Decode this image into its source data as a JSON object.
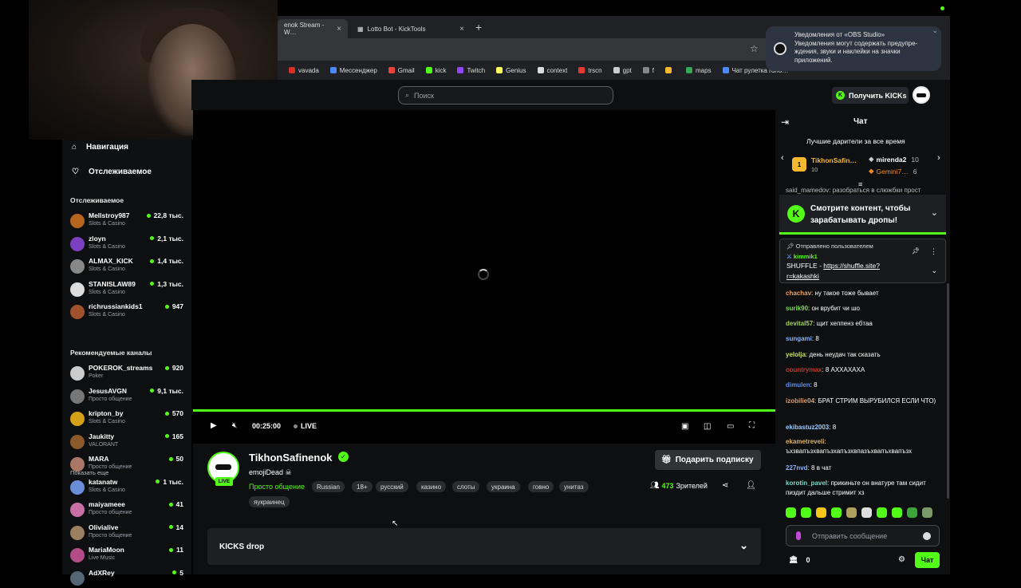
{
  "browser": {
    "tabs": [
      {
        "label": "enok Stream - W…"
      },
      {
        "label": "Lotto Bot - KickTools"
      }
    ],
    "new_tab": "+",
    "bookmarks": [
      {
        "label": "vavada",
        "color": "#d93025"
      },
      {
        "label": "Мессенджер",
        "color": "#4a8af4"
      },
      {
        "label": "Gmail",
        "color": "#ea4335"
      },
      {
        "label": "kick",
        "color": "#53fc18"
      },
      {
        "label": "Twitch",
        "color": "#9146ff"
      },
      {
        "label": "Genius",
        "color": "#ffff64"
      },
      {
        "label": "context",
        "color": "#dddddd"
      },
      {
        "label": "trscn",
        "color": "#e53935"
      },
      {
        "label": "gpt",
        "color": "#cccccc"
      },
      {
        "label": "f",
        "color": "#888888"
      },
      {
        "label": "",
        "color": "#f5b82e"
      },
      {
        "label": "maps",
        "color": "#34a853"
      },
      {
        "label": "Чат рулетка голо…",
        "color": "#4a8af4"
      }
    ]
  },
  "notification": {
    "title": "Уведомления от «OBS Studio»",
    "body": "Уведомления могут содержать предупре-ждения, звуки и наклейки на значки приложений."
  },
  "header": {
    "search_placeholder": "Поиск",
    "get_kicks": "Получить KICKs"
  },
  "sidebar": {
    "nav": [
      {
        "label": "Навигация",
        "icon": "home-icon"
      },
      {
        "label": "Отслеживаемое",
        "icon": "heart-icon"
      }
    ],
    "following_heading": "Отслеживаемое",
    "following": [
      {
        "name": "Mellstroy987",
        "category": "Slots & Casino",
        "viewers": "22,8 тыс.",
        "color": "#b5651d"
      },
      {
        "name": "zloyn",
        "category": "Slots & Casino",
        "viewers": "2,1 тыс.",
        "color": "#7b3fbf"
      },
      {
        "name": "ALMAX_KICK",
        "category": "Slots & Casino",
        "viewers": "1,4 тыс.",
        "color": "#888888"
      },
      {
        "name": "STANISLAW89",
        "category": "Slots & Casino",
        "viewers": "1,3 тыс.",
        "color": "#dddddd"
      },
      {
        "name": "richrussiankids1",
        "category": "Slots & Casino",
        "viewers": "947",
        "color": "#a0522d"
      }
    ],
    "show_more": "Показать еще",
    "recommended_heading": "Рекомендуемые каналы",
    "recommended": [
      {
        "name": "POKEROK_streams",
        "category": "Poker",
        "viewers": "920",
        "color": "#cccccc"
      },
      {
        "name": "JesusAVGN",
        "category": "Просто общение",
        "viewers": "9,1 тыс.",
        "color": "#777777"
      },
      {
        "name": "kripton_by",
        "category": "Slots & Casino",
        "viewers": "570",
        "color": "#d4a017"
      },
      {
        "name": "Jaukitty",
        "category": "VALORANT",
        "viewers": "165",
        "color": "#8b5a2b"
      },
      {
        "name": "MARA",
        "category": "Просто общение",
        "viewers": "50",
        "color": "#aa7766"
      },
      {
        "name": "katanatw",
        "category": "Slots & Casino",
        "viewers": "1 тыс.",
        "color": "#6a8fd8"
      },
      {
        "name": "maiyameee",
        "category": "Просто общение",
        "viewers": "41",
        "color": "#c86fa6"
      },
      {
        "name": "Olivialive",
        "category": "Просто общение",
        "viewers": "14",
        "color": "#9a8060"
      },
      {
        "name": "MariaMoon",
        "category": "Live Music",
        "viewers": "11",
        "color": "#b34d88"
      },
      {
        "name": "AdXRey",
        "category": "",
        "viewers": "5",
        "color": "#556677"
      }
    ]
  },
  "player": {
    "time": "00:25:00",
    "live_label": "LIVE",
    "progress_fraction": 1.0
  },
  "stream": {
    "streamer": "TikhonSafinenok",
    "live_badge": "LIVE",
    "title": "emojiDead ☠",
    "category": "Просто общение",
    "tags": [
      "Russian",
      "18+",
      "русский",
      "казино",
      "слоты",
      "украина",
      "говно",
      "унитаз",
      "яукраинец"
    ],
    "gift_sub": "Подарить подписку",
    "viewers_count": "473",
    "viewers_label": "Зрителей",
    "kicks_drop": "KICKS drop"
  },
  "chat": {
    "title": "Чат",
    "top_gifters_title": "Лучшие дарители за все время",
    "gifters": [
      {
        "rank": "1",
        "name": "TikhonSafin…",
        "count": "10"
      },
      {
        "name": "mirenda2",
        "count": "10"
      },
      {
        "name": "Gemini7…",
        "count": "6"
      }
    ],
    "partial_message": "said_mamedov: разобраться в слюжбки прост",
    "drops_banner": "Смотрите контент, чтобы зарабатывать дропы!",
    "pinned": {
      "header": "Отправлено пользователем",
      "user": "kimmik1",
      "text": "SHUFFLE - ",
      "link": "https://shuffle.site?r=kakashki"
    },
    "messages": [
      {
        "user": "chachav",
        "text": "ну такое тоже бывает",
        "color": "#e8a25a"
      },
      {
        "user": "surik90",
        "text": "он врубит чи шо",
        "color": "#7ed957"
      },
      {
        "user": "devital57",
        "text": "щит хеппенз ебтаа",
        "color": "#9fd35a"
      },
      {
        "user": "sungami",
        "text": "8",
        "color": "#8ab4f8"
      },
      {
        "user": "yelolja",
        "text": "день неудач так сказать",
        "color": "#c8e06a"
      },
      {
        "user": "countrymax",
        "text": "8 АХХАХАХА",
        "color": "#c0392b"
      },
      {
        "user": "dimulen",
        "text": "8",
        "color": "#5b8def"
      },
      {
        "user": "izobilie04",
        "text": "БРАТ СТРИМ ВЫРУБИЛСЯ ЕСЛИ ЧТО)",
        "color": "#d4a07a"
      },
      {
        "user": "ekibastuz2003",
        "text": "8",
        "color": "#9ecbff"
      },
      {
        "user": "ekametreveli",
        "text": "ъхзвапъзхвапъзхапъзхвпазъхвапъхвапъзх",
        "color": "#d9b36a"
      },
      {
        "user": "227nvd",
        "text": "8 в чат",
        "color": "#8ab4f8"
      },
      {
        "user": "korotin_pavel",
        "text": "прикиньте он внатуре там сидит пиздит дальше стримит хз",
        "color": "#7ed9c8"
      }
    ],
    "input_placeholder": "Отправить сообщение",
    "points": "0",
    "send": "Чат"
  }
}
